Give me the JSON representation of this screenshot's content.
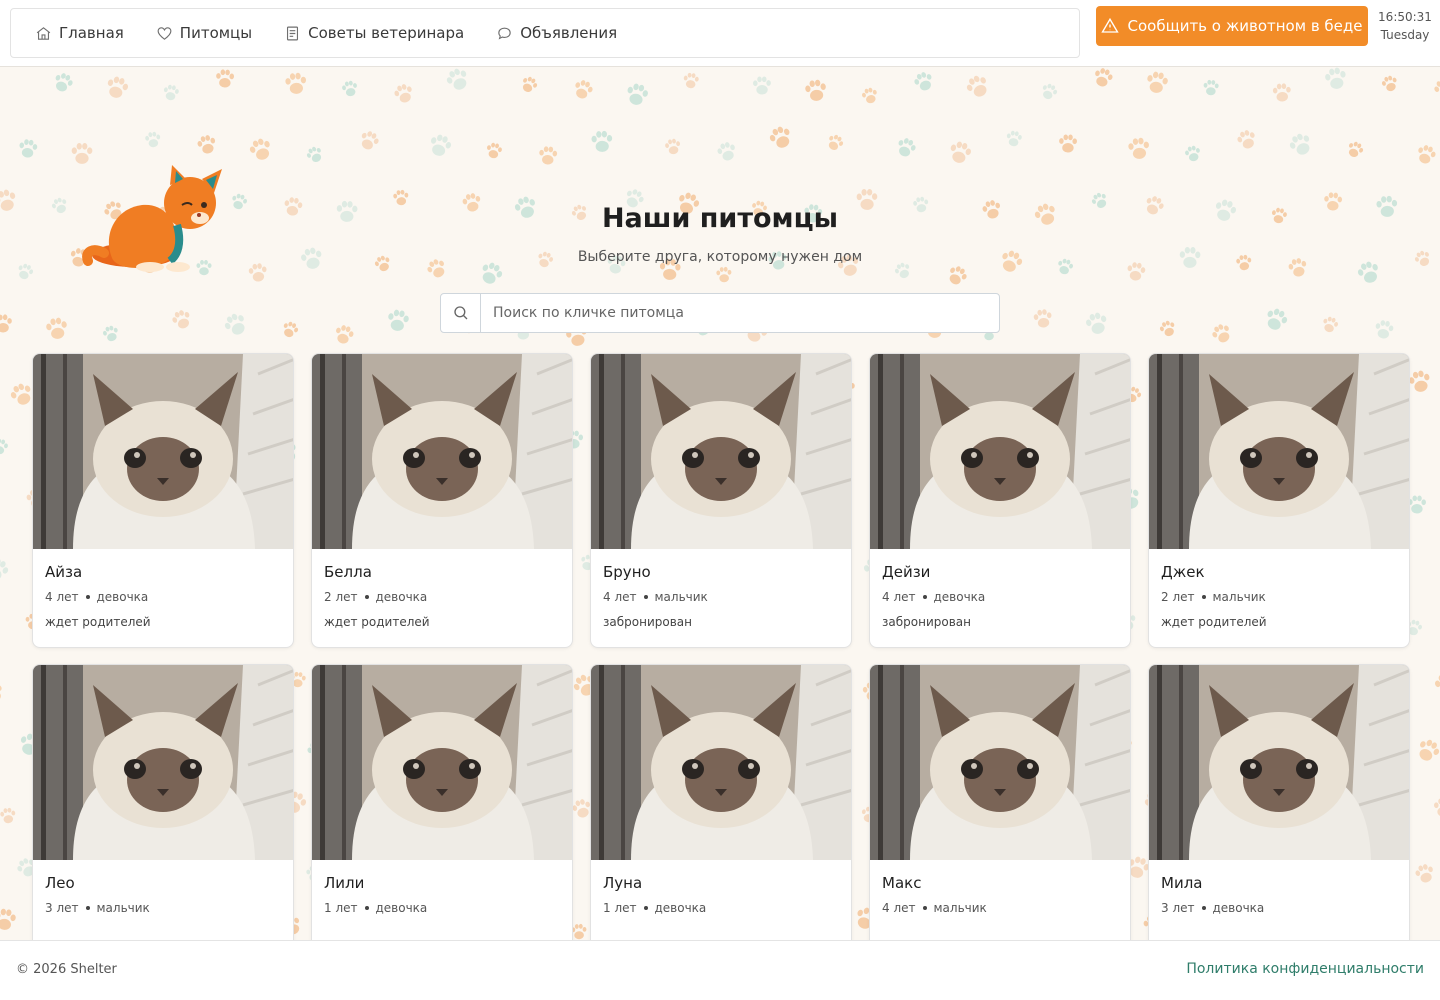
{
  "nav": {
    "items": [
      {
        "label": "Главная",
        "icon": "home-icon"
      },
      {
        "label": "Питомцы",
        "icon": "heart-icon"
      },
      {
        "label": "Советы ветеринара",
        "icon": "document-icon"
      },
      {
        "label": "Объявления",
        "icon": "chat-icon"
      }
    ]
  },
  "header": {
    "report_label": "Сообщить о животном в беде",
    "time": "16:50:31",
    "day": "Tuesday"
  },
  "main": {
    "title": "Наши питомцы",
    "subtitle": "Выберите друга, которому нужен дом",
    "search_placeholder": "Поиск по кличке питомца"
  },
  "pets": [
    {
      "name": "Айза",
      "age": "4 лет",
      "sex": "девочка",
      "status": "ждет родителей"
    },
    {
      "name": "Белла",
      "age": "2 лет",
      "sex": "девочка",
      "status": "ждет родителей"
    },
    {
      "name": "Бруно",
      "age": "4 лет",
      "sex": "мальчик",
      "status": "забронирован"
    },
    {
      "name": "Дейзи",
      "age": "4 лет",
      "sex": "девочка",
      "status": "забронирован"
    },
    {
      "name": "Джек",
      "age": "2 лет",
      "sex": "мальчик",
      "status": "ждет родителей"
    },
    {
      "name": "Лео",
      "age": "3 лет",
      "sex": "мальчик",
      "status": ""
    },
    {
      "name": "Лили",
      "age": "1 лет",
      "sex": "девочка",
      "status": ""
    },
    {
      "name": "Луна",
      "age": "1 лет",
      "sex": "девочка",
      "status": ""
    },
    {
      "name": "Макс",
      "age": "4 лет",
      "sex": "мальчик",
      "status": ""
    },
    {
      "name": "Мила",
      "age": "3 лет",
      "sex": "девочка",
      "status": ""
    }
  ],
  "footer": {
    "copyright": "© 2026 Shelter",
    "privacy": "Политика конфиденциальности"
  },
  "colors": {
    "accent": "#f28c28",
    "link": "#2f7d6a",
    "background": "#fbf7f1"
  }
}
